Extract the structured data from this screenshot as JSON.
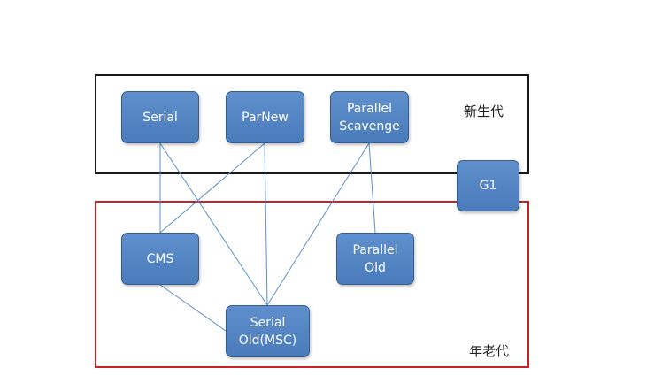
{
  "regions": {
    "young_label": "新生代",
    "old_label": "年老代"
  },
  "collectors": {
    "serial": "Serial",
    "parnew": "ParNew",
    "parallel_scavenge": "Parallel\nScavenge",
    "g1": "G1",
    "cms": "CMS",
    "parallel_old": "Parallel\nOld",
    "serial_old": "Serial\nOld(MSC)"
  },
  "connections": [
    [
      "Serial",
      "CMS"
    ],
    [
      "Serial",
      "Serial Old(MSC)"
    ],
    [
      "ParNew",
      "CMS"
    ],
    [
      "ParNew",
      "Serial Old(MSC)"
    ],
    [
      "Parallel Scavenge",
      "Serial Old(MSC)"
    ],
    [
      "Parallel Scavenge",
      "Parallel Old"
    ],
    [
      "CMS",
      "Serial Old(MSC)"
    ]
  ],
  "colors": {
    "node_fill": "#4f81bd",
    "connector": "#5b8ec7",
    "young_border": "#1a1a1a",
    "old_border": "#cc2026"
  }
}
